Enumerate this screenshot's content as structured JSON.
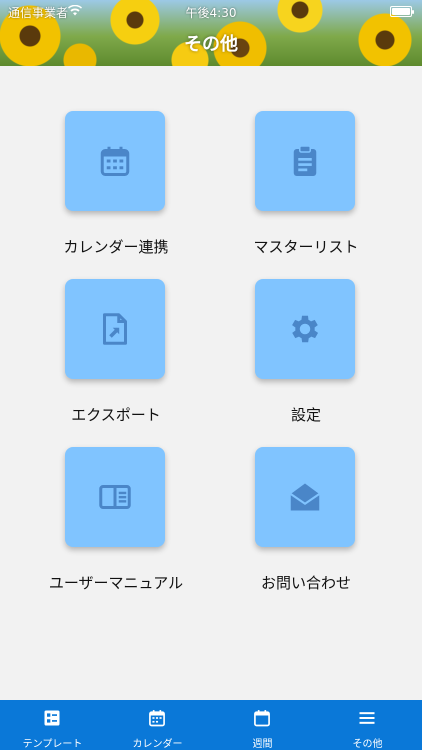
{
  "status_bar": {
    "carrier": "通信事業者",
    "time": "午後4:30"
  },
  "header": {
    "title": "その他"
  },
  "menu": {
    "items": [
      {
        "label": "カレンダー連携",
        "icon": "calendar-icon"
      },
      {
        "label": "マスターリスト",
        "icon": "clipboard-icon"
      },
      {
        "label": "エクスポート",
        "icon": "file-export-icon"
      },
      {
        "label": "設定",
        "icon": "gear-icon"
      },
      {
        "label": "ユーザーマニュアル",
        "icon": "book-icon"
      },
      {
        "label": "お問い合わせ",
        "icon": "envelope-open-icon"
      }
    ]
  },
  "tabbar": {
    "items": [
      {
        "label": "テンプレート",
        "icon": "template-icon"
      },
      {
        "label": "カレンダー",
        "icon": "calendar-icon"
      },
      {
        "label": "週間",
        "icon": "week-icon"
      },
      {
        "label": "その他",
        "icon": "menu-icon"
      }
    ]
  },
  "colors": {
    "tile": "#80c4ff",
    "tile_icon": "#4a86c8",
    "tabbar": "#0a78d8",
    "background": "#f2f2f2"
  }
}
